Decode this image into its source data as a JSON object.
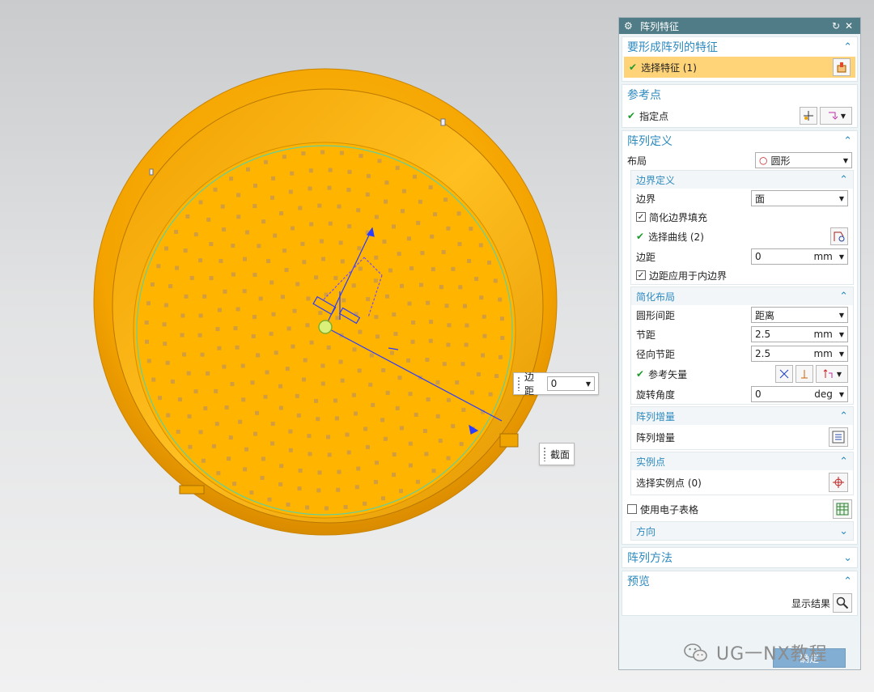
{
  "dialog": {
    "title": "阵列特征",
    "reset_icon": "refresh-icon",
    "close_icon": "close-icon",
    "features_group": {
      "title": "要形成阵列的特征",
      "select_label": "选择特征 (1)"
    },
    "ref_point_group": {
      "title": "参考点",
      "point_label": "指定点"
    },
    "pattern_def_group": {
      "title": "阵列定义",
      "layout_label": "布局",
      "layout_value": "圆形",
      "boundary_sub": {
        "title": "边界定义",
        "boundary_label": "边界",
        "boundary_value": "面",
        "simplify_fill_label": "简化边界填充",
        "select_curve_label": "选择曲线 (2)",
        "margin_label": "边距",
        "margin_value": "0",
        "margin_unit": "mm",
        "apply_inner_label": "边距应用于内边界"
      },
      "simplified_layout_sub": {
        "title": "简化布局",
        "circ_spacing_label": "圆形间距",
        "circ_spacing_value": "距离",
        "pitch_label": "节距",
        "pitch_value": "2.5",
        "pitch_unit": "mm",
        "radial_pitch_label": "径向节距",
        "radial_pitch_value": "2.5",
        "radial_pitch_unit": "mm",
        "ref_vector_label": "参考矢量",
        "rotation_label": "旋转角度",
        "rotation_value": "0",
        "rotation_unit": "deg"
      },
      "increment_sub": {
        "title": "阵列增量",
        "row_label": "阵列增量"
      },
      "instance_sub": {
        "title": "实例点",
        "row_label": "选择实例点 (0)"
      },
      "spreadsheet_label": "使用电子表格",
      "direction_sub": {
        "title": "方向"
      }
    },
    "method_group": {
      "title": "阵列方法"
    },
    "preview_group": {
      "title": "预览",
      "show_result_label": "显示结果"
    }
  },
  "viewport": {
    "margin_box": {
      "label": "边距",
      "value": "0"
    },
    "section_box": {
      "label": "截面"
    }
  },
  "watermark": {
    "text": "UG一NX教程",
    "icon": "wechat-icon"
  },
  "ok_label": "确定",
  "colors": {
    "titlebar": "#4f7c86",
    "accent": "#2d8abf",
    "part": "#f7a800",
    "highlight": "#ffd479"
  }
}
